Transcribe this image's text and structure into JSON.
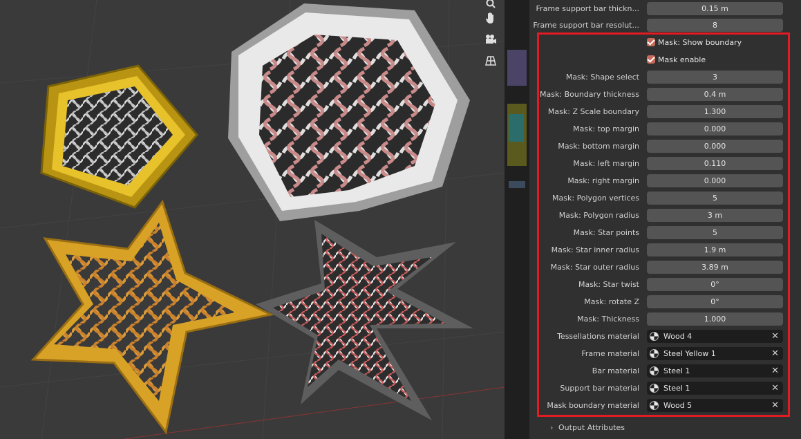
{
  "top_rows": [
    {
      "label": "Frame support bar thickn...",
      "value": "0.15 m"
    },
    {
      "label": "Frame support bar resolut...",
      "value": "8"
    }
  ],
  "checkboxes": [
    {
      "label": "Mask: Show boundary",
      "checked": true
    },
    {
      "label": "Mask enable",
      "checked": true
    }
  ],
  "mask_rows": [
    {
      "label": "Mask: Shape select",
      "value": "3"
    },
    {
      "label": "Mask: Boundary thickness",
      "value": "0.4 m"
    },
    {
      "label": "Mask: Z Scale boundary",
      "value": "1.300"
    },
    {
      "label": "Mask: top margin",
      "value": "0.000"
    },
    {
      "label": "Mask: bottom margin",
      "value": "0.000"
    },
    {
      "label": "Mask: left margin",
      "value": "0.110"
    },
    {
      "label": "Mask: right margin",
      "value": "0.000"
    },
    {
      "label": "Mask: Polygon vertices",
      "value": "5"
    },
    {
      "label": "Mask: Polygon radius",
      "value": "3 m"
    },
    {
      "label": "Mask: Star points",
      "value": "5"
    },
    {
      "label": "Mask: Star inner radius",
      "value": "1.9 m"
    },
    {
      "label": "Mask: Star outer radius",
      "value": "3.89 m"
    },
    {
      "label": "Mask: Star twist",
      "value": "0°"
    },
    {
      "label": "Mask: rotate Z",
      "value": "0°"
    },
    {
      "label": "Mask: Thickness",
      "value": "1.000"
    }
  ],
  "material_rows": [
    {
      "label": "Tessellations material",
      "value": "Wood 4"
    },
    {
      "label": "Frame material",
      "value": "Steel Yellow 1"
    },
    {
      "label": "Bar material",
      "value": "Steel 1"
    },
    {
      "label": "Support bar material",
      "value": "Steel 1"
    },
    {
      "label": "Mask boundary material",
      "value": "Wood 5"
    }
  ],
  "clear_glyph": "✕",
  "footer": {
    "chevron": "›",
    "label": "Output Attributes"
  },
  "colors": {
    "highlight": "#e31b23",
    "checkbox": "#c96b5b",
    "field": "#545454",
    "material_field": "#1d1d1d"
  },
  "viewport_tools": [
    "zoom-icon",
    "hand-icon",
    "camera-icon",
    "grid-icon"
  ]
}
